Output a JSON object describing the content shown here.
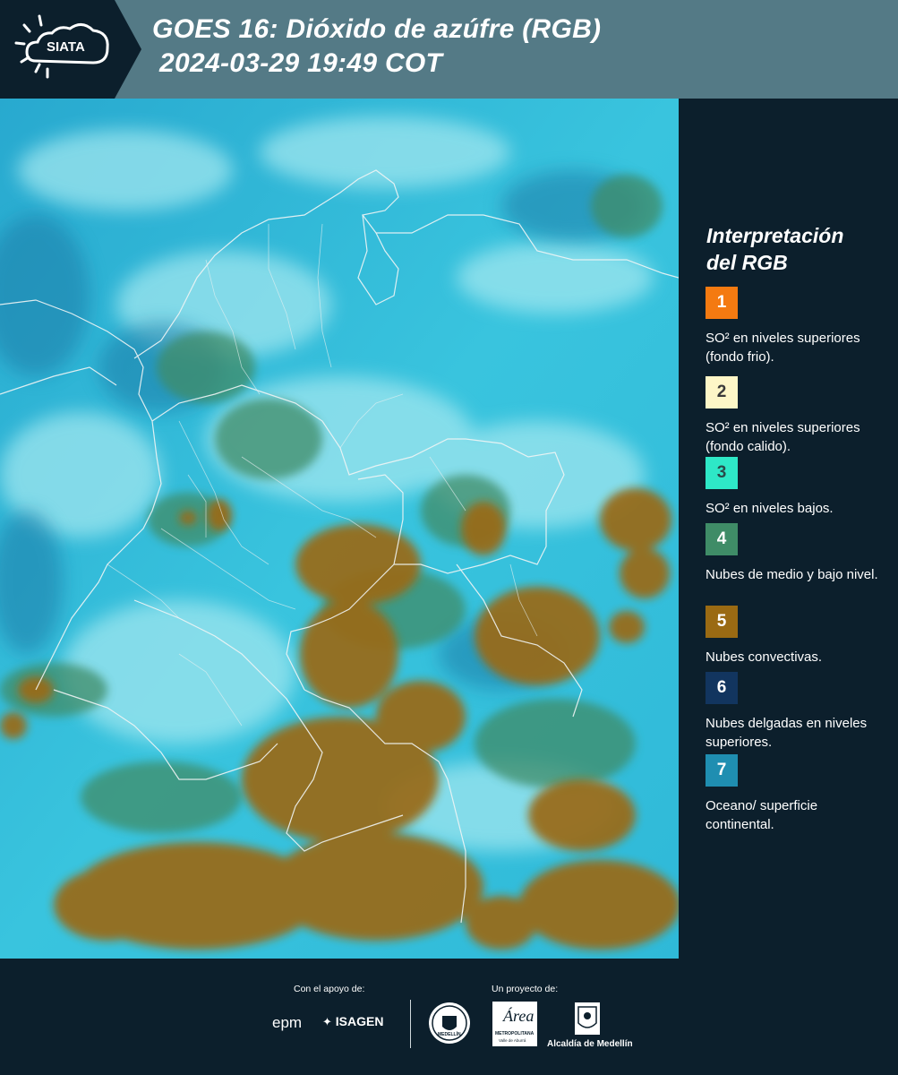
{
  "header": {
    "logo_text": "SIATA",
    "title_line1": "GOES 16: Dióxido de azúfre (RGB)",
    "title_line2": "2024-03-29 19:49 COT"
  },
  "legend": {
    "title_line1": "Interpretación",
    "title_line2": "del RGB",
    "items": [
      {
        "number": "1",
        "label": "SO² en niveles superiores (fondo frio).",
        "color": "#f47a11",
        "num_color": "#ffffff"
      },
      {
        "number": "2",
        "label": "SO² en niveles superiores (fondo calido).",
        "color": "#fdf6c7",
        "num_color": "#3a3a3a"
      },
      {
        "number": "3",
        "label": "SO² en niveles bajos.",
        "color": "#2ee8c7",
        "num_color": "#2a4a4a"
      },
      {
        "number": "4",
        "label": "Nubes de medio y bajo nivel.",
        "color": "#3f8c67",
        "num_color": "#ffffff"
      },
      {
        "number": "5",
        "label": "Nubes convectivas.",
        "color": "#9a6a13",
        "num_color": "#ffffff"
      },
      {
        "number": "6",
        "label": "Nubes delgadas en niveles superiores.",
        "color": "#12355f",
        "num_color": "#ffffff"
      },
      {
        "number": "7",
        "label": "Oceano/ superficie continental.",
        "color": "#1f8eb1",
        "num_color": "#ffffff"
      }
    ]
  },
  "footer": {
    "support_label": "Con el apoyo de:",
    "project_label": "Un proyecto de:",
    "sponsor1": "epm",
    "sponsor2": "ISAGEN",
    "partner1": "MEDELLÍN",
    "partner2": "Área",
    "partner2_sub": "METROPOLITANA",
    "partner2_sub2": "Valle de Aburrá",
    "partner3": "Alcaldía de Medellín"
  }
}
